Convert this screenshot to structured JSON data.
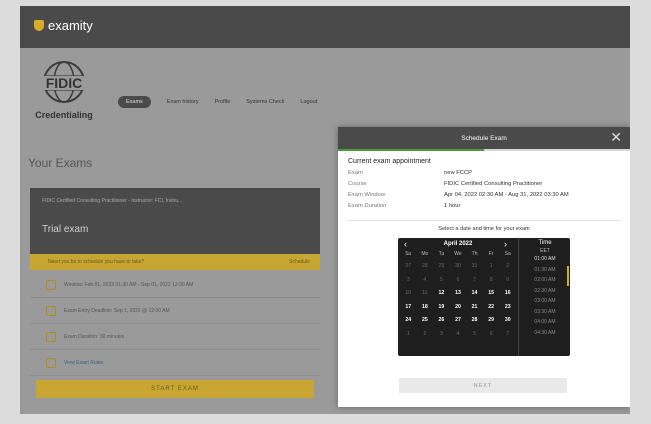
{
  "brand": {
    "name": "examity"
  },
  "logo": {
    "text": "FIDIC",
    "subtitle": "Credentialing"
  },
  "nav": {
    "items": [
      "Exams",
      "Exam history",
      "Profile",
      "Systems Check",
      "Logout"
    ]
  },
  "page": {
    "title": "Your Exams"
  },
  "exam_card": {
    "header": "FIDIC Certified Consulting Practitioner - Instructor: FCI, Instru...",
    "title": "Trial exam",
    "banner_left": "Need you be to schedule you have to take?",
    "banner_right": "Schedule",
    "info": [
      {
        "label": "Window: Feb 01, 2022 01:30 AM - Sep 01, 2022 12:30 AM",
        "icon": "calendar-icon"
      },
      {
        "label": "Exam Entry Deadline: Sep 1, 2022 @ 12:00 AM",
        "icon": "clock-icon"
      },
      {
        "label": "Exam Duration: 30 minutes",
        "icon": "timer-icon"
      },
      {
        "label": "View Exam Rules",
        "icon": "document-icon"
      }
    ],
    "start_label": "START EXAM"
  },
  "modal": {
    "title": "Schedule Exam",
    "close": "✕",
    "progress": 0.5,
    "section_title": "Current exam appointment",
    "fields": [
      {
        "k": "Exam",
        "v": "new FCCP"
      },
      {
        "k": "Course",
        "v": "FIDIC Certified Consulting Practitioner"
      },
      {
        "k": "Exam Window",
        "v": "Apr 04, 2022 02:30 AM - Aug 31, 2022 03:30 AM"
      },
      {
        "k": "Exam Duration",
        "v": "1 hour"
      }
    ],
    "prompt": "Select a date and time for your exam",
    "calendar": {
      "month": "April 2022",
      "prev": "‹",
      "next": "›",
      "weekdays": [
        "Su",
        "Mo",
        "Tu",
        "We",
        "Th",
        "Fr",
        "Sa"
      ],
      "days": [
        [
          "27",
          "28",
          "29",
          "30",
          "31",
          "1",
          "2"
        ],
        [
          "3",
          "4",
          "5",
          "6",
          "7",
          "8",
          "9"
        ],
        [
          "10",
          "11",
          "12",
          "13",
          "14",
          "15",
          "16"
        ],
        [
          "17",
          "18",
          "19",
          "20",
          "21",
          "22",
          "23"
        ],
        [
          "24",
          "25",
          "26",
          "27",
          "28",
          "29",
          "30"
        ],
        [
          "1",
          "2",
          "3",
          "4",
          "5",
          "6",
          "7"
        ]
      ],
      "muted": [
        [
          1,
          1,
          1,
          1,
          1,
          1,
          1
        ],
        [
          1,
          1,
          1,
          1,
          1,
          1,
          1
        ],
        [
          1,
          1,
          0,
          0,
          0,
          0,
          0
        ],
        [
          0,
          0,
          0,
          0,
          0,
          0,
          0
        ],
        [
          0,
          0,
          0,
          0,
          0,
          0,
          0
        ],
        [
          1,
          1,
          1,
          1,
          1,
          1,
          1
        ]
      ]
    },
    "time": {
      "header": "Time",
      "tz": "EET",
      "slots": [
        "01:00 AM",
        "01:30 AM",
        "02:00 AM",
        "02:30 AM",
        "03:00 AM",
        "03:30 AM",
        "04:00 AM",
        "04:30 AM"
      ]
    },
    "next_label": "NEXT"
  }
}
